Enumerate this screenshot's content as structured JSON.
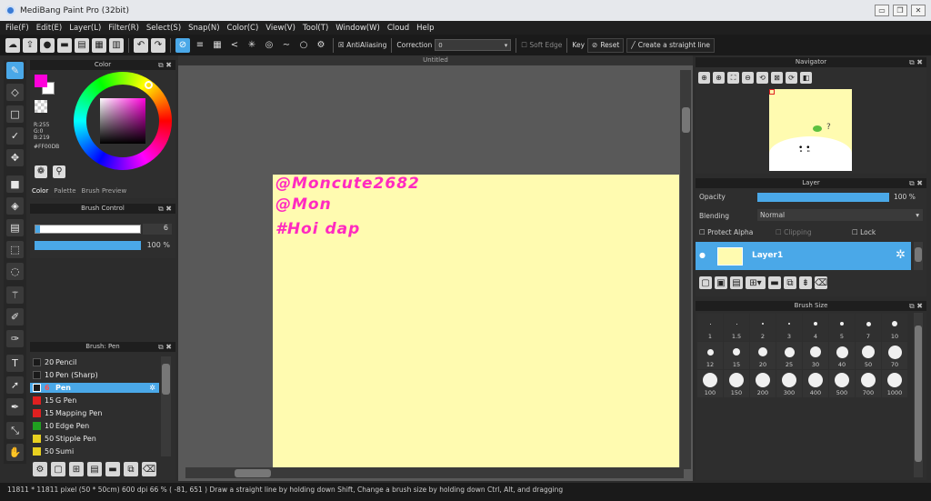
{
  "window": {
    "title": "MediBang Paint Pro (32bit)"
  },
  "menu": [
    "File(F)",
    "Edit(E)",
    "Layer(L)",
    "Filter(R)",
    "Select(S)",
    "Snap(N)",
    "Color(C)",
    "View(V)",
    "Tool(T)",
    "Window(W)",
    "Cloud",
    "Help"
  ],
  "toolbar": {
    "antialiasing": "AntiAliasing",
    "correction_label": "Correction",
    "correction_value": "0",
    "soft_edge": "Soft Edge",
    "key": "Key",
    "reset": "Reset",
    "straight_line": "Create a straight line"
  },
  "color_panel": {
    "title": "Color",
    "r": "R:255",
    "g": "G:0",
    "b": "B:219",
    "hex": "#FF00DB",
    "tabs": [
      "Color",
      "Palette",
      "Brush Preview"
    ],
    "accent": "#FF00DB"
  },
  "brush_control": {
    "title": "Brush Control",
    "size": "6",
    "opacity": "100 %"
  },
  "brush_list": {
    "title": "Brush: Pen",
    "items": [
      {
        "size": "20",
        "name": "Pencil",
        "color": "#1a1a1a"
      },
      {
        "size": "10",
        "name": "Pen (Sharp)",
        "color": "#1a1a1a"
      },
      {
        "size": "6",
        "name": "Pen",
        "color": "#1a1a1a"
      },
      {
        "size": "15",
        "name": "G Pen",
        "color": "#e02020"
      },
      {
        "size": "15",
        "name": "Mapping Pen",
        "color": "#e02020"
      },
      {
        "size": "10",
        "name": "Edge Pen",
        "color": "#20a020"
      },
      {
        "size": "50",
        "name": "Stipple Pen",
        "color": "#e8d020"
      },
      {
        "size": "50",
        "name": "Sumi",
        "color": "#e8d020"
      }
    ]
  },
  "canvas": {
    "tab": "Untitled",
    "line1": "@Moncute2682",
    "line2": "@Mon",
    "line3": "#Hoi dap",
    "ink": "#FF2AC0",
    "paper": "#FFFBB0"
  },
  "navigator": {
    "title": "Navigator"
  },
  "layer": {
    "title": "Layer",
    "opacity_label": "Opacity",
    "opacity_value": "100 %",
    "blending_label": "Blending",
    "blending_value": "Normal",
    "protect_alpha": "Protect Alpha",
    "clipping": "Clipping",
    "lock": "Lock",
    "layer_name": "Layer1"
  },
  "brush_size": {
    "title": "Brush Size",
    "sizes": [
      "1",
      "1.5",
      "2",
      "3",
      "4",
      "5",
      "7",
      "10",
      "12",
      "15",
      "20",
      "25",
      "30",
      "40",
      "50",
      "70",
      "100",
      "150",
      "200",
      "300",
      "400",
      "500",
      "700",
      "1000"
    ]
  },
  "status": "11811 * 11811 pixel  (50 * 50cm)  600 dpi  66 %  ( -81, 651 )  Draw a straight line by holding down Shift, Change a brush size by holding down Ctrl, Alt, and dragging"
}
